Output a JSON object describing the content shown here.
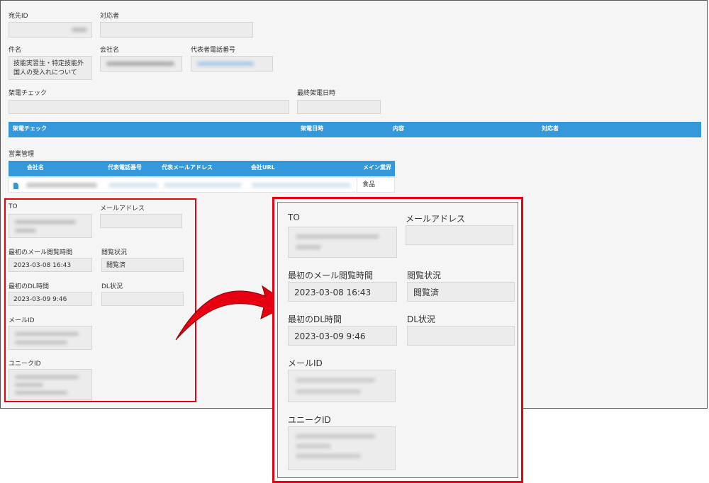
{
  "record": {
    "dest_id_label": "宛先ID",
    "assignee_label": "対応者",
    "subject_label": "件名",
    "subject_value": "技能実習生・特定技能外国人の受入れについて",
    "company_label": "会社名",
    "rep_phone_label": "代表者電話番号",
    "call_check_label": "架電チェック",
    "last_call_label": "最終架電日時"
  },
  "call_table": {
    "headers": [
      "架電チェック",
      "架電日時",
      "内容",
      "対応者"
    ]
  },
  "sales": {
    "section_label": "営業管理",
    "headers": [
      "会社名",
      "代表電話番号",
      "代表メールアドレス",
      "会社URL",
      "メイン業界"
    ],
    "row_industry": "食品"
  },
  "email_panel": {
    "to_label": "TO",
    "mail_address_label": "メールアドレス",
    "first_open_label": "最初のメール閲覧時間",
    "first_open_value": "2023-03-08 16:43",
    "view_status_label": "閲覧状況",
    "view_status_value": "閲覧済",
    "first_dl_label": "最初のDL時間",
    "first_dl_value": "2023-03-09 9:46",
    "dl_status_label": "DL状況",
    "dl_status_value": "",
    "mail_id_label": "メールID",
    "unique_id_label": "ユニークID"
  },
  "colors": {
    "accent_bar": "#3498db",
    "highlight": "#e60012",
    "field_bg": "#ececec",
    "panel_bg": "#f5f5f5"
  }
}
